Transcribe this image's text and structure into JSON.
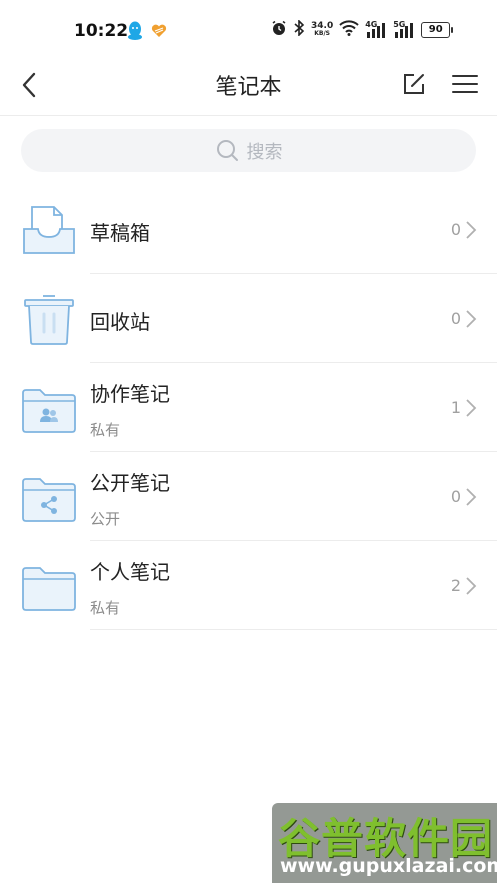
{
  "status_bar": {
    "time": "10:22",
    "net_speed": "34.0",
    "net_speed_unit": "KB/S",
    "signal1": "4G",
    "signal2": "5G",
    "battery": "90"
  },
  "header": {
    "title": "笔记本"
  },
  "search": {
    "placeholder": "搜索"
  },
  "items": [
    {
      "name": "草稿箱",
      "count": "0"
    },
    {
      "name": "回收站",
      "count": "0"
    },
    {
      "name": "协作笔记",
      "sub": "私有",
      "count": "1"
    },
    {
      "name": "公开笔记",
      "sub": "公开",
      "count": "0"
    },
    {
      "name": "个人笔记",
      "sub": "私有",
      "count": "2"
    }
  ],
  "watermark": {
    "title": "谷普软件园",
    "url": "www.gupuxlazai.com"
  },
  "colors": {
    "icon_stroke": "#7fb4e0",
    "icon_fill": "#eaf3fb",
    "divider": "#ececec",
    "search_bg": "#f3f4f6"
  }
}
